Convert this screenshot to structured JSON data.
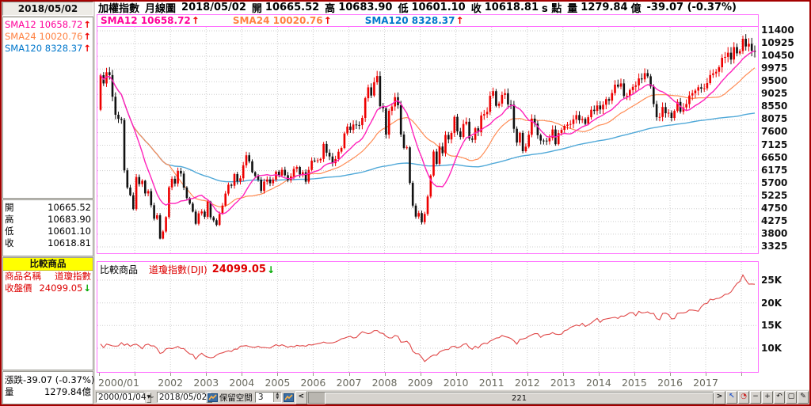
{
  "header": {
    "instrument": "加權指數",
    "period": "月線圖",
    "date": "2018/05/02",
    "open_label": "開",
    "open": "10665.52",
    "high_label": "高",
    "high": "10683.90",
    "low_label": "低",
    "low": "10601.10",
    "close_label": "收",
    "close": "10618.81",
    "close_suffix": "s 點",
    "vol_label": "量",
    "vol": "1279.84",
    "vol_unit": "億",
    "change": "-39.07 (-0.37%)"
  },
  "sidebar": {
    "date": "2018/05/02",
    "sma_rows": [
      {
        "label": "SMA12",
        "value": "10658.72",
        "arrow": "↑"
      },
      {
        "label": "SMA24",
        "value": "10020.76",
        "arrow": "↑"
      },
      {
        "label": "SMA120",
        "value": "8328.37",
        "arrow": "↑"
      }
    ],
    "ohlc_rows": [
      {
        "label": "開",
        "value": "10665.52"
      },
      {
        "label": "高",
        "value": "10683.90"
      },
      {
        "label": "低",
        "value": "10601.10"
      },
      {
        "label": "收",
        "value": "10618.81"
      }
    ],
    "cmp_title": "比較商品",
    "cmp_rows": [
      {
        "label": "商品名稱",
        "value": "道瓊指數"
      },
      {
        "label": "收盤價",
        "value": "24099.05",
        "arrow": "↓"
      }
    ],
    "chg_rows": [
      {
        "label": "漲跌",
        "value": "-39.07 (-0.37%)"
      },
      {
        "label": "量",
        "value": "1279.84億"
      }
    ]
  },
  "legend": {
    "rows": [
      {
        "label": "SMA12",
        "value": "10658.72",
        "arrow": "↑"
      },
      {
        "label": "SMA24",
        "value": "10020.76",
        "arrow": "↑"
      },
      {
        "label": "SMA120",
        "value": "8328.37",
        "arrow": "↑"
      }
    ]
  },
  "comparison_header": {
    "title": "比較商品",
    "name": "道瓊指數(DJI)",
    "value": "24099.05",
    "arrow": "↓"
  },
  "statusbar": {
    "range_start": "2000/01/04",
    "tilde": "~",
    "range_end": "2018/05/02",
    "reserve_label": "保留空間",
    "reserve_value": "3",
    "scroll_left": "<",
    "bar_count": "221",
    "scroll_right": ">",
    "tools": [
      "↖",
      "◔",
      "−",
      "+",
      "↶",
      "▢",
      "✎"
    ]
  },
  "colors": {
    "window_border": "#a40000",
    "panel_gray": "#d6d3ce",
    "chart_border": "#ff70ff",
    "grid": "#cdcdcd",
    "candle_up": "#ee0000",
    "candle_down": "#111111",
    "sma12": "#ff22bb",
    "sma24": "#ff8c55",
    "sma120": "#4fa8d8",
    "dji_line": "#e04848",
    "highlight_yellow": "#ffff00",
    "up_arrow": "#ee0000",
    "down_arrow": "#00a800"
  },
  "chart_data": [
    {
      "type": "candlestick",
      "title": "加權指數 月線圖 (TAIEX monthly)",
      "x_start": "2000/01",
      "x_end": "2018/05",
      "x_labels": [
        "2000/01",
        "2002",
        "2003",
        "2004",
        "2005",
        "2006",
        "2007",
        "2008",
        "2009",
        "2010",
        "2011",
        "2012",
        "2013",
        "2014",
        "2015",
        "2016",
        "2017"
      ],
      "y_ticks": [
        11400,
        10925,
        10450,
        9975,
        9500,
        9025,
        8550,
        8075,
        7600,
        7125,
        6650,
        6175,
        5700,
        5225,
        4750,
        4275,
        3800,
        3325
      ],
      "ylim": [
        3325,
        11400
      ],
      "grid": true,
      "first_open": 8450,
      "up_color": "#ee0000",
      "down_color": "#111111",
      "sma": [
        {
          "period": 12,
          "color": "#ff22bb",
          "last": 10658.72
        },
        {
          "period": 24,
          "color": "#ff8c55",
          "last": 10020.76
        },
        {
          "period": 120,
          "color": "#4fa8d8",
          "last": 8328.37
        }
      ],
      "closes": [
        9744,
        9435,
        9854,
        9747,
        8940,
        8265,
        8114,
        8070,
        6185,
        5544,
        5256,
        4739,
        5936,
        5674,
        5797,
        5323,
        5410,
        4883,
        4380,
        4509,
        3636,
        3903,
        4441,
        5551,
        5872,
        5696,
        6167,
        6065,
        5542,
        5153,
        4942,
        4644,
        4191,
        4579,
        4647,
        4452,
        5015,
        4432,
        4321,
        4148,
        4555,
        4872,
        5318,
        5650,
        5611,
        6045,
        5772,
        5890,
        6375,
        6750,
        6522,
        6117,
        5977,
        5839,
        5420,
        5765,
        5845,
        5705,
        5844,
        6139,
        5994,
        6207,
        6005,
        5818,
        5962,
        6241,
        6312,
        6033,
        6118,
        5764,
        6203,
        6548,
        6532,
        6561,
        6614,
        7172,
        6847,
        6704,
        6454,
        6611,
        6884,
        7021,
        7568,
        7824,
        7699,
        7902,
        7884,
        7875,
        8145,
        8883,
        9287,
        8982,
        9477,
        9711,
        8586,
        8506,
        7521,
        8413,
        8573,
        8920,
        8619,
        7524,
        7024,
        7046,
        5719,
        4870,
        4460,
        4591,
        4248,
        4557,
        5210,
        5993,
        6890,
        6432,
        7078,
        6826,
        7509,
        7340,
        7583,
        8188,
        7640,
        7436,
        7920,
        8004,
        7374,
        7329,
        7760,
        7616,
        8237,
        8287,
        8372,
        8972,
        9145,
        8599,
        8683,
        9007,
        9068,
        8652,
        8644,
        7741,
        7225,
        7587,
        6904,
        7072,
        7517,
        8121,
        7933,
        7501,
        7301,
        7296,
        7270,
        7397,
        7715,
        7166,
        7580,
        7699,
        7850,
        7898,
        7918,
        8093,
        8254,
        8062,
        8107,
        7925,
        8173,
        8450,
        8406,
        8611,
        8462,
        8639,
        8849,
        8791,
        9075,
        9393,
        9315,
        9436,
        8966,
        8974,
        9187,
        9307,
        9361,
        9622,
        9586,
        9820,
        9701,
        9323,
        8665,
        8174,
        8181,
        8554,
        8320,
        8338,
        8145,
        8411,
        8744,
        8377,
        8535,
        8666,
        8984,
        9068,
        9166,
        9290,
        9240,
        9253,
        9447,
        9750,
        9811,
        9872,
        10040,
        10395,
        10427,
        10585,
        10329,
        10793,
        10560,
        10642,
        11103,
        10815,
        10919,
        10657,
        10618.81
      ]
    },
    {
      "type": "line",
      "title": "道瓊指數(DJI)",
      "y_tick_labels": [
        "25K",
        "20K",
        "15K",
        "10K"
      ],
      "y_tick_values": [
        25000,
        20000,
        15000,
        10000
      ],
      "grid": true,
      "color": "#e04848",
      "last": 24099.05,
      "closes": [
        10940,
        10128,
        10922,
        10734,
        10522,
        10448,
        10522,
        11215,
        10651,
        10971,
        10414,
        10787,
        10887,
        10495,
        9879,
        10735,
        10912,
        10502,
        10523,
        9950,
        8848,
        9075,
        9852,
        10022,
        9920,
        10106,
        10404,
        9946,
        9925,
        9243,
        8737,
        8664,
        7592,
        8397,
        8896,
        8342,
        8054,
        7891,
        7992,
        8480,
        8850,
        8985,
        9234,
        9416,
        9275,
        9801,
        9782,
        10454,
        10488,
        10584,
        10358,
        10226,
        10188,
        10435,
        10140,
        10174,
        10080,
        10027,
        10428,
        10783,
        10490,
        10766,
        10504,
        10193,
        10467,
        10275,
        10641,
        10482,
        10569,
        10440,
        10806,
        10718,
        10865,
        10993,
        11109,
        11367,
        11168,
        11150,
        11186,
        11381,
        11679,
        12080,
        12222,
        12463,
        12622,
        12269,
        12354,
        13063,
        13628,
        13409,
        13212,
        13358,
        13896,
        13930,
        13372,
        13265,
        12650,
        12266,
        12263,
        12820,
        12638,
        11350,
        11378,
        11544,
        10851,
        9325,
        8829,
        8776,
        8001,
        7063,
        7609,
        8168,
        8500,
        8447,
        9172,
        9496,
        9712,
        9713,
        10345,
        10428,
        10067,
        10325,
        10857,
        11009,
        10137,
        9774,
        10466,
        10015,
        10788,
        11118,
        11006,
        11578,
        11892,
        12226,
        12320,
        12811,
        12570,
        12414,
        12143,
        11614,
        10913,
        11955,
        12046,
        12218,
        12633,
        12952,
        13212,
        13214,
        12393,
        12880,
        13009,
        13091,
        13437,
        13096,
        13026,
        13104,
        13861,
        14054,
        14579,
        14840,
        15116,
        14910,
        15500,
        14810,
        15130,
        15546,
        16086,
        16577,
        15699,
        16322,
        16458,
        16581,
        16717,
        16827,
        16563,
        17098,
        17043,
        17391,
        17828,
        17823,
        17165,
        18133,
        17776,
        17841,
        18011,
        17620,
        17690,
        16528,
        16285,
        17664,
        17720,
        17425,
        16466,
        16517,
        17685,
        17774,
        17787,
        17930,
        18432,
        18401,
        18308,
        18142,
        19124,
        19763,
        19864,
        20812,
        20663,
        20941,
        21009,
        21350,
        21891,
        21948,
        22405,
        23377,
        24272,
        24719,
        26149,
        25029,
        24103,
        24163,
        24099.05
      ]
    }
  ]
}
